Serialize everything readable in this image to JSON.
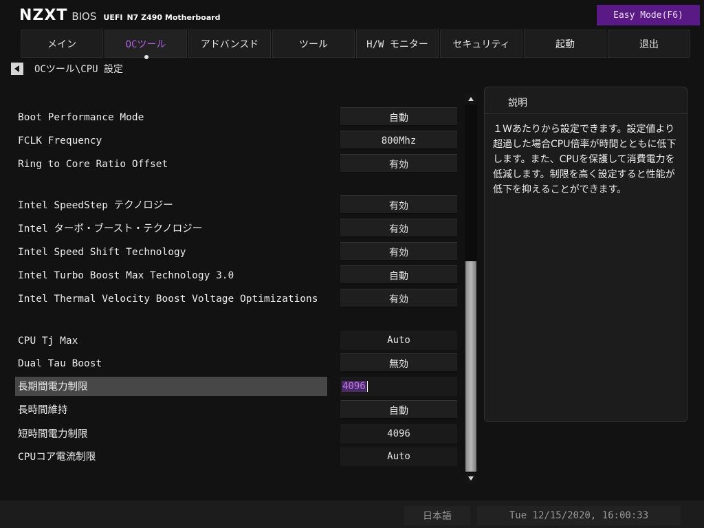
{
  "header": {
    "brand": "NZXT",
    "bios": "BIOS",
    "uefi": "UEFI",
    "board": "N7 Z490 Motherboard",
    "easy_mode_label": "Easy Mode(F6)",
    "easy_mode_color": "#5a1a86"
  },
  "tabs": [
    {
      "label": "メイン"
    },
    {
      "label": "OCツール",
      "active": true
    },
    {
      "label": "アドバンスド"
    },
    {
      "label": "ツール"
    },
    {
      "label": "H/W モニター"
    },
    {
      "label": "セキュリティ"
    },
    {
      "label": "起動"
    },
    {
      "label": "退出"
    }
  ],
  "breadcrumb": {
    "back_icon": "triangle-left-icon",
    "path": "OCツール\\CPU 設定"
  },
  "settings": [
    {
      "label": "Boot Performance Mode",
      "value": "自動"
    },
    {
      "label": "FCLK Frequency",
      "value": "800Mhz"
    },
    {
      "label": "Ring to Core Ratio Offset",
      "value": "有効"
    },
    {
      "label": "Intel SpeedStep テクノロジー",
      "value": "有効"
    },
    {
      "label": "Intel ターボ・ブースト・テクノロジー",
      "value": "有効"
    },
    {
      "label": "Intel Speed Shift Technology",
      "value": "有効"
    },
    {
      "label": "Intel Turbo Boost Max Technology 3.0",
      "value": "自動"
    },
    {
      "label": "Intel Thermal Velocity Boost Voltage Optimizations",
      "value": "有効"
    },
    {
      "label": "CPU Tj Max",
      "value": "Auto"
    },
    {
      "label": "Dual Tau Boost",
      "value": "無効"
    },
    {
      "label": "長期間電力制限",
      "value": "4096"
    },
    {
      "label": "長時間維持",
      "value": "自動"
    },
    {
      "label": "短時間電力制限",
      "value": "4096"
    },
    {
      "label": "CPUコア電流制限",
      "value": "Auto"
    }
  ],
  "help": {
    "title": "説明",
    "text": "１Wあたりから設定できます。設定値より超過した場合CPU倍率が時間とともに低下します。また、CPUを保護して消費電力を低減します。制限を高く設定すると性能が低下を抑えることができます。"
  },
  "footer": {
    "language": "日本語",
    "datetime": "Tue 12/15/2020, 16:00:33"
  },
  "colors": {
    "accent": "#b060e0",
    "background": "#121212"
  }
}
